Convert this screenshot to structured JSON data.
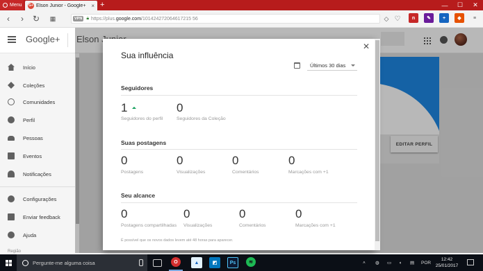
{
  "browser": {
    "menu_label": "Menu",
    "tab_title": "Elson Junior - Google+",
    "tab_favicon": "G+",
    "new_tab_glyph": "+",
    "vpn_label": "VPN",
    "url_prefix": "https://plus.",
    "url_domain": "google.com",
    "url_path": "/101424272064617215 56",
    "minimize_glyph": "—",
    "maximize_glyph": "☐",
    "close_glyph": "✕"
  },
  "gplus": {
    "logo": "Google+",
    "profile_name": "Elson Junior"
  },
  "sidebar": {
    "items": [
      {
        "label": "Início",
        "icon": "home-icon"
      },
      {
        "label": "Coleções",
        "icon": "collections-icon"
      },
      {
        "label": "Comunidades",
        "icon": "communities-icon"
      },
      {
        "label": "Perfil",
        "icon": "profile-icon"
      },
      {
        "label": "Pessoas",
        "icon": "people-icon"
      },
      {
        "label": "Eventos",
        "icon": "events-icon"
      },
      {
        "label": "Notificações",
        "icon": "bell-icon"
      },
      {
        "label": "Configurações",
        "icon": "gear-icon"
      },
      {
        "label": "Enviar feedback",
        "icon": "feedback-icon"
      },
      {
        "label": "Ajuda",
        "icon": "help-icon"
      }
    ],
    "region_label": "Região"
  },
  "profile": {
    "edit_button": "EDITAR PERFIL"
  },
  "dialog": {
    "title": "Sua influência",
    "close_glyph": "✕",
    "range_selected": "Últimos 30 dias",
    "sections": {
      "followers": {
        "title": "Seguidores",
        "stats": [
          {
            "value": "1",
            "label": "Seguidores do perfil"
          },
          {
            "value": "0",
            "label": "Seguidores da Coleção"
          }
        ]
      },
      "posts": {
        "title": "Suas postagens",
        "stats": [
          {
            "value": "0",
            "label": "Postagens"
          },
          {
            "value": "0",
            "label": "Visualizações"
          },
          {
            "value": "0",
            "label": "Comentários"
          },
          {
            "value": "0",
            "label": "Marcações com +1"
          }
        ]
      },
      "reach": {
        "title": "Seu alcance",
        "stats": [
          {
            "value": "0",
            "label": "Postagens compartilhadas"
          },
          {
            "value": "0",
            "label": "Visualizações"
          },
          {
            "value": "0",
            "label": "Comentários"
          },
          {
            "value": "0",
            "label": "Marcações com +1"
          }
        ]
      }
    },
    "footnote": "É possível que os novos dados levem até 48 horas para aparecer."
  },
  "taskbar": {
    "search_placeholder": "Pergunte-me alguma coisa",
    "language": "POR",
    "time": "12:42",
    "date": "25/01/2017"
  },
  "colors": {
    "opera_red": "#b71c1c",
    "cover_blue": "#1e88e5",
    "trend_green": "#0f9d58"
  }
}
